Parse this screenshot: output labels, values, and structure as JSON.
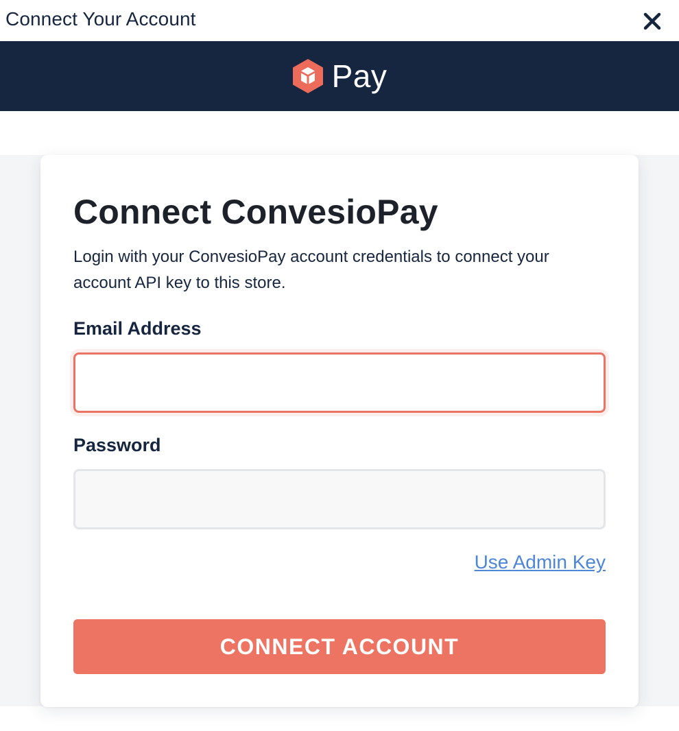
{
  "window": {
    "title": "Connect Your Account",
    "close_icon": "close-icon"
  },
  "brand": {
    "name": "Pay",
    "logo_icon": "cube-logo-icon",
    "logo_color": "#ec6b5a",
    "bar_color": "#162641"
  },
  "form": {
    "heading": "Connect ConvesioPay",
    "description": "Login with your ConvesioPay account credentials to connect your account API key to this store.",
    "email": {
      "label": "Email Address",
      "value": "",
      "placeholder": ""
    },
    "password": {
      "label": "Password",
      "value": "",
      "placeholder": ""
    },
    "admin_key_link": "Use Admin Key",
    "submit_label": "CONNECT ACCOUNT",
    "accent_color": "#ed7462",
    "link_color": "#4e86d6"
  }
}
